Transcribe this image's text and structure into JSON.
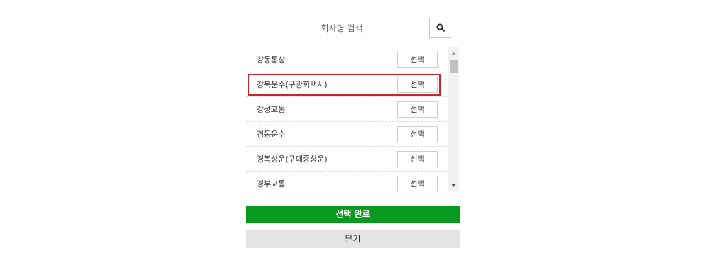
{
  "search": {
    "placeholder": "회사명 검색",
    "button_icon": "search-icon"
  },
  "companies": [
    {
      "name": "강동통상",
      "select_label": "선택",
      "highlighted": false
    },
    {
      "name": "강북운수(구광회택시)",
      "select_label": "선택",
      "highlighted": true
    },
    {
      "name": "강성교통",
      "select_label": "선택",
      "highlighted": false
    },
    {
      "name": "경동운수",
      "select_label": "선택",
      "highlighted": false
    },
    {
      "name": "경복상운(구대중상운)",
      "select_label": "선택",
      "highlighted": false
    },
    {
      "name": "경부교통",
      "select_label": "선택",
      "highlighted": false
    }
  ],
  "actions": {
    "confirm_label": "선택 완료",
    "close_label": "닫기"
  },
  "colors": {
    "confirm_bg": "#07991f",
    "close_bg": "#e3e3e3",
    "highlight_border": "#c9252c"
  }
}
